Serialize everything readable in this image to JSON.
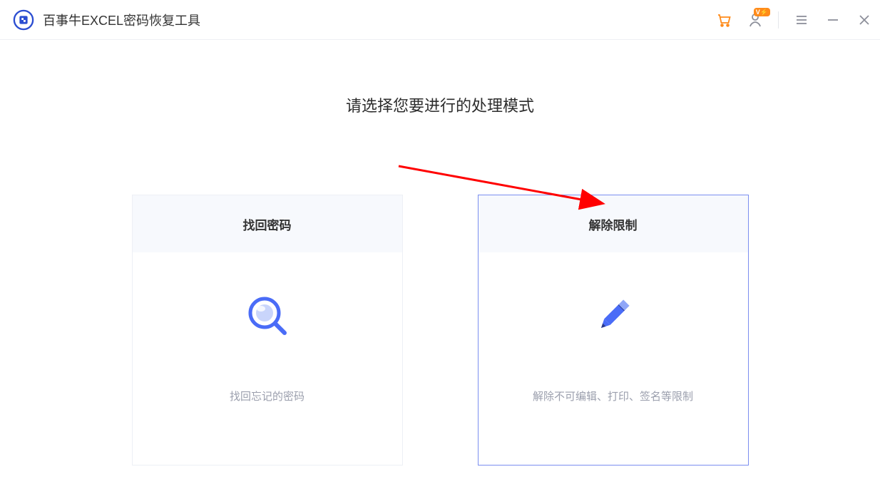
{
  "header": {
    "app_title": "百事牛EXCEL密码恢复工具",
    "icons": {
      "cart": "shopping-cart",
      "user": "user-account",
      "vip_badge": "V⚡",
      "menu": "hamburger-menu",
      "minimize": "minimize",
      "close": "close"
    }
  },
  "main": {
    "heading": "请选择您要进行的处理模式",
    "cards": [
      {
        "title": "找回密码",
        "description": "找回忘记的密码",
        "icon": "magnifier",
        "selected": false
      },
      {
        "title": "解除限制",
        "description": "解除不可编辑、打印、签名等限制",
        "icon": "pencil",
        "selected": true
      }
    ]
  },
  "annotation": {
    "arrow_points_to": "card-remove-restriction"
  }
}
